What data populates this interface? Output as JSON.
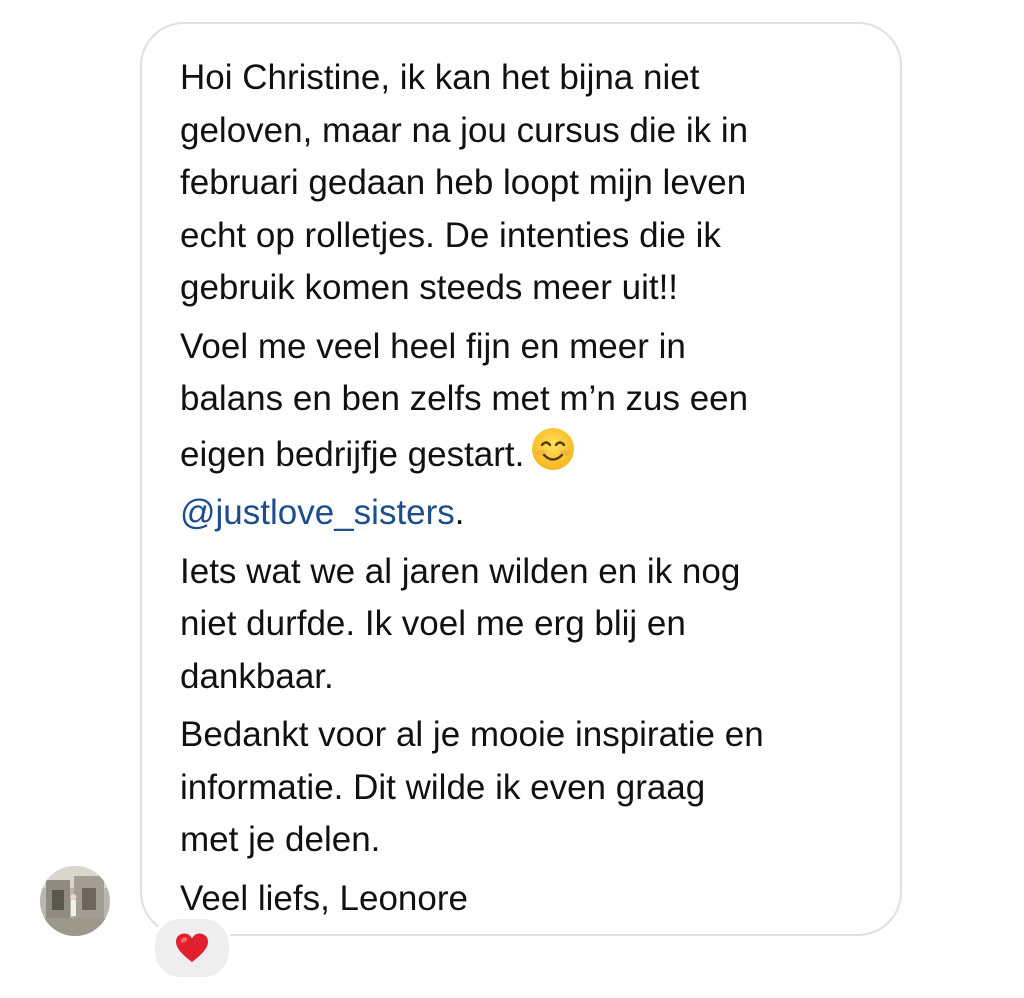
{
  "message": {
    "lines": [
      "Hoi Christine, ik kan het bijna niet",
      "geloven, maar na jou cursus die ik in",
      "februari gedaan heb loopt mijn leven",
      "echt op rolletjes. De intenties die ik",
      "gebruik komen steeds meer uit!!",
      "Voel me veel heel fijn en meer in",
      "balans en ben zelfs met m’n zus een",
      "eigen bedrijfje gestart.",
      "@justlove_sisters",
      ".",
      "Iets wat we al jaren wilden en ik nog",
      "niet durfde. Ik voel me erg blij en",
      "dankbaar.",
      "Bedankt voor al je mooie inspiratie en",
      "informatie. Dit wilde ik even graag",
      "met je delen.",
      "Veel liefs, Leonore"
    ],
    "emoji": "smiling-face-emoji",
    "mention_color": "#1c4e8c"
  },
  "reaction": {
    "icon": "red-heart-icon",
    "color": "#e0202e"
  },
  "avatar": {
    "icon": "profile-photo"
  },
  "colors": {
    "bubble_border": "#e0e0e0",
    "text": "#111111",
    "reaction_bg": "#eeeeee"
  }
}
